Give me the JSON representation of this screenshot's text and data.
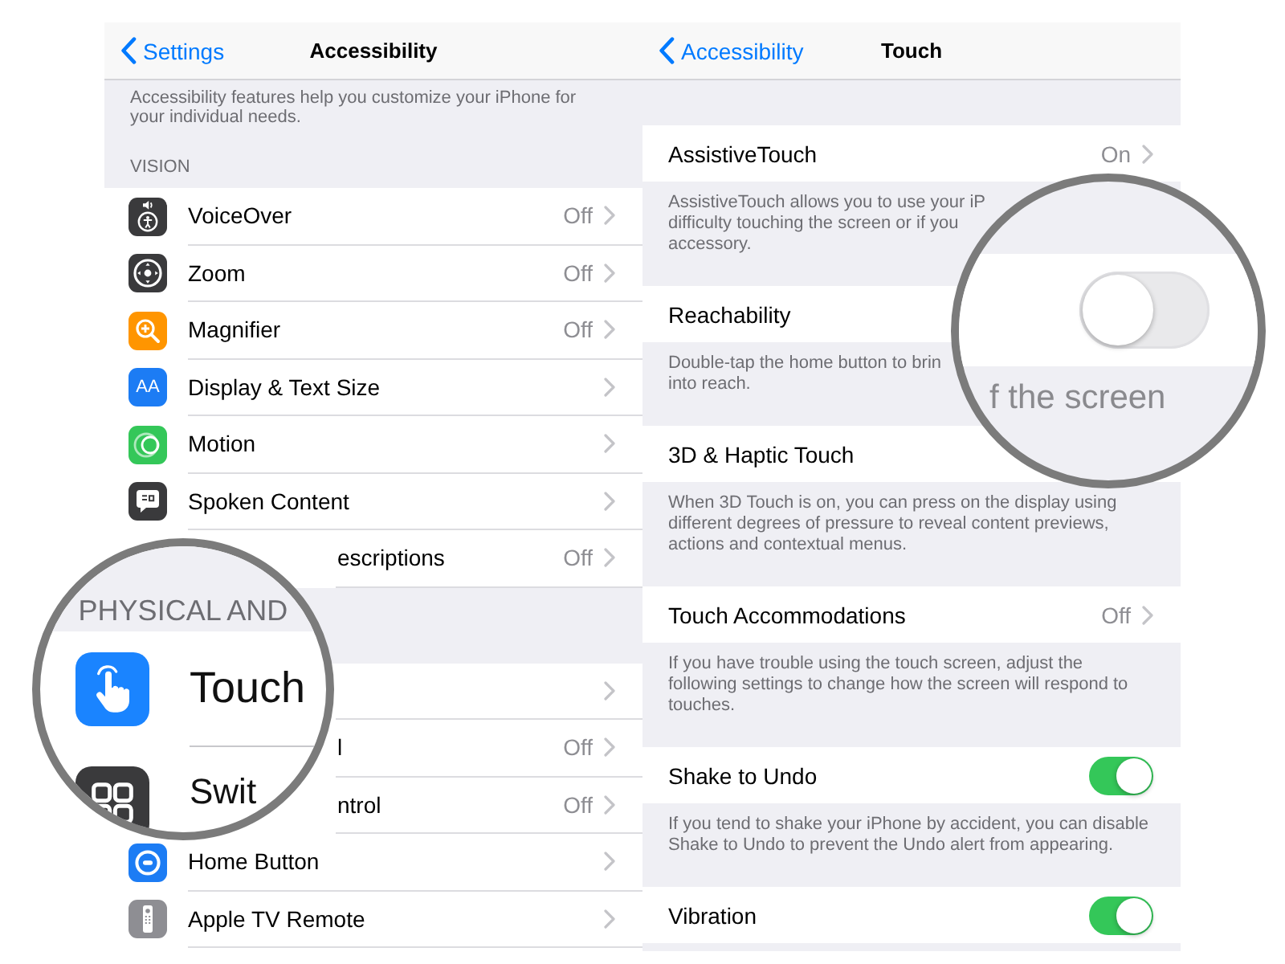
{
  "left_screen": {
    "nav_bar": {
      "back": "Settings",
      "title": "Accessibility"
    },
    "intro": {
      "lines": [
        "Accessibility features help you customize your iPhone for",
        "your individual needs."
      ]
    },
    "sections": [
      {
        "header": "VISION",
        "items": [
          {
            "kind": "link",
            "label": "VoiceOver",
            "value": "Off",
            "color": "#3a3a3c"
          },
          {
            "kind": "link",
            "label": "Zoom",
            "value": "Off",
            "color": "#3a3a3c"
          },
          {
            "kind": "link",
            "label": "Magnifier",
            "value": "Off",
            "color": "#ff9500"
          },
          {
            "kind": "link",
            "label": "Display & Text Size",
            "color": "#1c7cf4",
            "icon_text": "AA"
          },
          {
            "kind": "link",
            "label": "Motion",
            "color": "#34c759"
          },
          {
            "kind": "link",
            "label": "Spoken Content",
            "color": "#3a3a3c"
          },
          {
            "kind": "link",
            "label": "escriptions",
            "value": "Off"
          }
        ]
      },
      {
        "items": [
          {
            "kind": "link"
          },
          {
            "kind": "link",
            "label": "l",
            "value": "Off"
          },
          {
            "kind": "link",
            "label": "ntrol",
            "value": "Off"
          },
          {
            "kind": "link",
            "label": "Home Button",
            "color": "#1c7cf4"
          },
          {
            "kind": "link",
            "label": "Apple TV Remote",
            "color": "#8e8e93"
          }
        ]
      }
    ]
  },
  "left_magnifier": {
    "header": "PHYSICAL AND",
    "items": [
      {
        "label": "Touch",
        "color": "#1a84ff"
      },
      {
        "label": "Swit",
        "color": "#3a3a3c"
      }
    ]
  },
  "right_screen": {
    "nav_bar": {
      "back": "Accessibility",
      "title": "Touch"
    },
    "groups": [
      {
        "kind": "link",
        "label": "AssistiveTouch",
        "value": "On",
        "footer": [
          "AssistiveTouch allows you to use your iP",
          "difficulty touching the screen or if you",
          "accessory."
        ]
      },
      {
        "kind": "plain",
        "label": "Reachability",
        "footer": [
          "Double-tap the home button to brin",
          "into reach."
        ]
      },
      {
        "kind": "plain",
        "label": "3D & Haptic Touch",
        "footer": [
          "When 3D Touch is on, you can press on the display using",
          "different degrees of pressure to reveal content previews,",
          "actions and contextual menus."
        ]
      },
      {
        "kind": "link",
        "label": "Touch Accommodations",
        "value": "Off",
        "footer": [
          "If you have trouble using the touch screen, adjust the",
          "following settings to change how the screen will respond to",
          "touches."
        ]
      },
      {
        "kind": "toggle",
        "label": "Shake to Undo",
        "on": true,
        "footer": [
          "If you tend to shake your iPhone by accident, you can disable",
          "Shake to Undo to prevent the Undo alert from appearing."
        ]
      },
      {
        "kind": "toggle",
        "label": "Vibration",
        "on": true
      }
    ]
  },
  "right_magnifier": {
    "toggle": {
      "on": false
    },
    "caption": "f the screen"
  }
}
